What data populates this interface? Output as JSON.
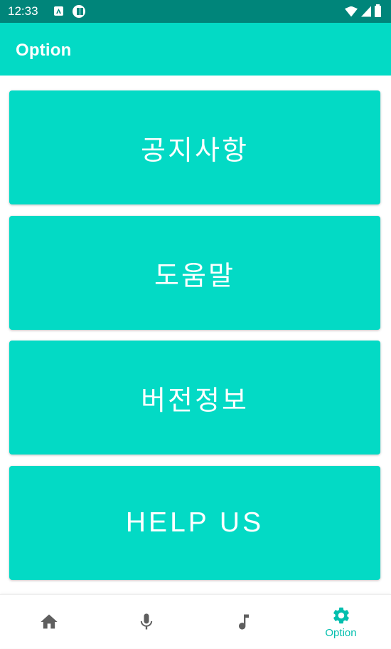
{
  "status_bar": {
    "time": "12:33"
  },
  "app_bar": {
    "title": "Option"
  },
  "menu": {
    "items": [
      {
        "label": "공지사항"
      },
      {
        "label": "도움말"
      },
      {
        "label": "버전정보"
      },
      {
        "label": "HELP US"
      }
    ]
  },
  "bottom_nav": {
    "items": [
      {
        "icon": "home-icon",
        "label": ""
      },
      {
        "icon": "mic-icon",
        "label": ""
      },
      {
        "icon": "music-note-icon",
        "label": ""
      },
      {
        "icon": "gear-icon",
        "label": "Option",
        "selected": true
      }
    ]
  },
  "colors": {
    "accent": "#03dac5",
    "status_bar": "#00857a",
    "nav_active": "#03bfae",
    "nav_inactive": "#5f5f5f"
  }
}
